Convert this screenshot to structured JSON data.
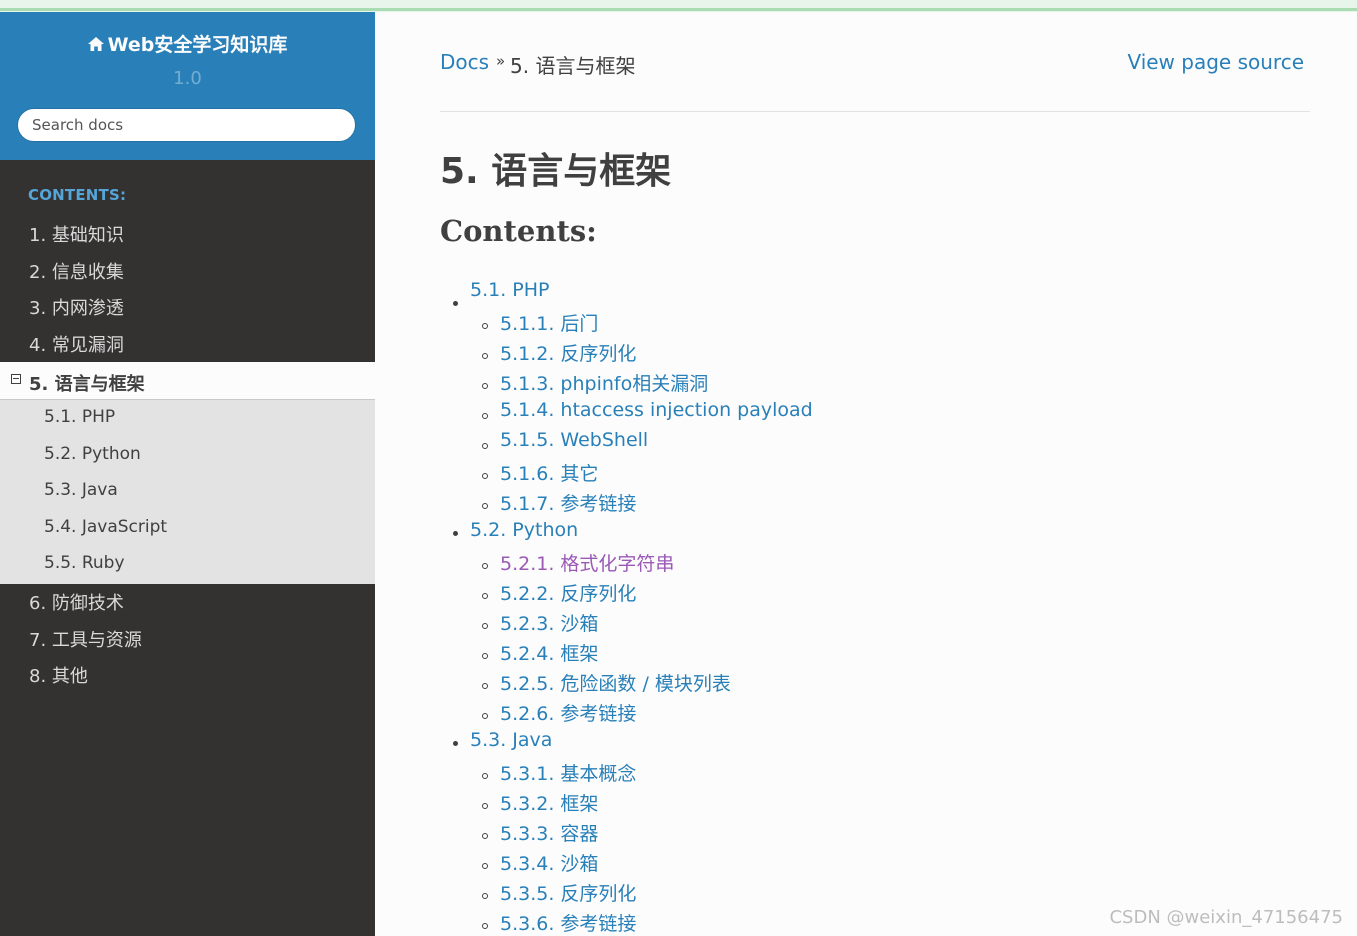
{
  "sidebar": {
    "brand": "Web安全学习知识库",
    "brand_icon": "home-icon",
    "version": "1.0",
    "search_placeholder": "Search docs",
    "caption": "CONTENTS:",
    "items": [
      {
        "label": "1. 基础知识"
      },
      {
        "label": "2. 信息收集"
      },
      {
        "label": "3. 内网渗透"
      },
      {
        "label": "4. 常见漏洞"
      },
      {
        "label": "5. 语言与框架",
        "current": true,
        "children": [
          {
            "label": "5.1. PHP"
          },
          {
            "label": "5.2. Python"
          },
          {
            "label": "5.3. Java"
          },
          {
            "label": "5.4. JavaScript"
          },
          {
            "label": "5.5. Ruby"
          }
        ]
      },
      {
        "label": "6. 防御技术"
      },
      {
        "label": "7. 工具与资源"
      },
      {
        "label": "8. 其他"
      }
    ]
  },
  "breadcrumb": {
    "home": "Docs",
    "separator": "»",
    "current": "5. 语言与框架",
    "view_source": "View page source"
  },
  "main": {
    "title": "5. 语言与框架",
    "contents_heading": "Contents:",
    "toc": [
      {
        "label": "5.1. PHP",
        "children": [
          {
            "label": "5.1.1. 后门"
          },
          {
            "label": "5.1.2. 反序列化"
          },
          {
            "label": "5.1.3. phpinfo相关漏洞"
          },
          {
            "label": "5.1.4. htaccess injection payload"
          },
          {
            "label": "5.1.5. WebShell"
          },
          {
            "label": "5.1.6. 其它"
          },
          {
            "label": "5.1.7. 参考链接"
          }
        ]
      },
      {
        "label": "5.2. Python",
        "children": [
          {
            "label": "5.2.1. 格式化字符串",
            "visited": true
          },
          {
            "label": "5.2.2. 反序列化"
          },
          {
            "label": "5.2.3. 沙箱"
          },
          {
            "label": "5.2.4. 框架"
          },
          {
            "label": "5.2.5. 危险函数 / 模块列表"
          },
          {
            "label": "5.2.6. 参考链接"
          }
        ]
      },
      {
        "label": "5.3. Java",
        "children": [
          {
            "label": "5.3.1. 基本概念"
          },
          {
            "label": "5.3.2. 框架"
          },
          {
            "label": "5.3.3. 容器"
          },
          {
            "label": "5.3.4. 沙箱"
          },
          {
            "label": "5.3.5. 反序列化"
          },
          {
            "label": "5.3.6. 参考链接"
          }
        ]
      }
    ]
  },
  "watermark": "CSDN @weixin_47156475",
  "colors": {
    "link": "#2980b9",
    "visited": "#9b59b6",
    "sidebar_bg": "#343131",
    "header_bg": "#2980b9"
  }
}
